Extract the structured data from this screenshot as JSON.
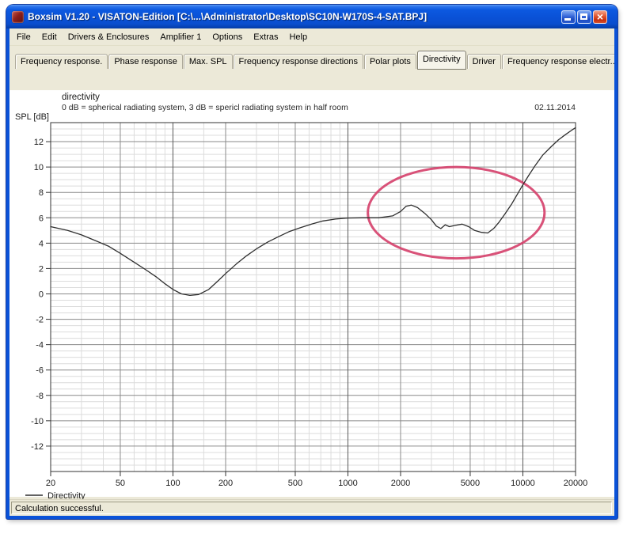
{
  "window": {
    "title": "Boxsim V1.20 - VISATON-Edition [C:\\...\\Administrator\\Desktop\\SC10N-W170S-4-SAT.BPJ]"
  },
  "menu": {
    "items": [
      "File",
      "Edit",
      "Drivers & Enclosures",
      "Amplifier 1",
      "Options",
      "Extras",
      "Help"
    ]
  },
  "tabs": {
    "active": "Directivity",
    "items": [
      "Frequency response.",
      "Phase response",
      "Max. SPL",
      "Frequency response directions",
      "Polar plots",
      "Directivity",
      "Driver",
      "Frequency response electr.."
    ]
  },
  "status": {
    "text": "Calculation successful."
  },
  "colors": {
    "accent_titlebar": "#0a52d8",
    "chrome_bg": "#ece9d8",
    "grid_minor": "#dcdcdc",
    "grid_major": "#8a8a8a",
    "grid_decade": "#5a5a5a",
    "plot_border": "#333333",
    "curve": "#2e2e2e",
    "annotation": "#d6436e"
  },
  "chart_data": {
    "type": "line",
    "title": "directivity",
    "subtitle": "0 dB = spherical radiating system, 3 dB = spericl radiating system in half room",
    "date_label": "02.11.2014",
    "ylabel": "SPL [dB]",
    "xscale": "log",
    "xlim": [
      20,
      20000
    ],
    "ylim": [
      -14,
      13.5
    ],
    "grid": "on",
    "legend_position": "bottom-left",
    "y_tick_values": [
      12,
      10,
      8,
      6,
      4,
      2,
      0,
      -2,
      -4,
      -6,
      -8,
      -10,
      -12
    ],
    "y_minor_step": 0.5,
    "y_major_step": 2,
    "x_tick_labels": [
      "20",
      "50",
      "100",
      "200",
      "500",
      "1000",
      "2000",
      "5000",
      "10000",
      "20000"
    ],
    "x_tick_values": [
      20,
      50,
      100,
      200,
      500,
      1000,
      2000,
      5000,
      10000,
      20000
    ],
    "x_decade_lines": [
      100,
      1000,
      10000
    ],
    "x_labeled_lines": [
      50,
      200,
      500,
      2000,
      5000
    ],
    "x_minor_lines": [
      30,
      40,
      60,
      70,
      80,
      90,
      150,
      300,
      400,
      600,
      700,
      800,
      900,
      1500,
      3000,
      4000,
      6000,
      7000,
      8000,
      9000,
      15000
    ],
    "series": [
      {
        "name": "Directivity",
        "points": [
          [
            20,
            5.3
          ],
          [
            25,
            5.0
          ],
          [
            30,
            4.65
          ],
          [
            36,
            4.2
          ],
          [
            43,
            3.75
          ],
          [
            50,
            3.2
          ],
          [
            60,
            2.5
          ],
          [
            70,
            1.9
          ],
          [
            80,
            1.35
          ],
          [
            90,
            0.8
          ],
          [
            100,
            0.35
          ],
          [
            112,
            0.0
          ],
          [
            125,
            -0.12
          ],
          [
            140,
            -0.05
          ],
          [
            160,
            0.35
          ],
          [
            180,
            1.0
          ],
          [
            200,
            1.6
          ],
          [
            230,
            2.35
          ],
          [
            260,
            2.95
          ],
          [
            300,
            3.55
          ],
          [
            350,
            4.1
          ],
          [
            400,
            4.5
          ],
          [
            460,
            4.9
          ],
          [
            530,
            5.2
          ],
          [
            620,
            5.5
          ],
          [
            720,
            5.75
          ],
          [
            850,
            5.9
          ],
          [
            1000,
            5.98
          ],
          [
            1200,
            6.0
          ],
          [
            1500,
            6.0
          ],
          [
            1800,
            6.15
          ],
          [
            2000,
            6.5
          ],
          [
            2150,
            6.9
          ],
          [
            2300,
            7.0
          ],
          [
            2500,
            6.8
          ],
          [
            2750,
            6.35
          ],
          [
            3000,
            5.85
          ],
          [
            3200,
            5.35
          ],
          [
            3400,
            5.15
          ],
          [
            3600,
            5.45
          ],
          [
            3800,
            5.3
          ],
          [
            4100,
            5.4
          ],
          [
            4500,
            5.5
          ],
          [
            4900,
            5.3
          ],
          [
            5300,
            5.0
          ],
          [
            5800,
            4.85
          ],
          [
            6300,
            4.8
          ],
          [
            6800,
            5.15
          ],
          [
            7300,
            5.65
          ],
          [
            7900,
            6.3
          ],
          [
            8600,
            7.05
          ],
          [
            9300,
            7.85
          ],
          [
            10000,
            8.6
          ],
          [
            10800,
            9.35
          ],
          [
            11800,
            10.15
          ],
          [
            13000,
            10.95
          ],
          [
            14500,
            11.6
          ],
          [
            16000,
            12.15
          ],
          [
            17500,
            12.55
          ],
          [
            19000,
            12.9
          ],
          [
            20000,
            13.1
          ]
        ]
      }
    ],
    "annotation_ellipse": {
      "f_min": 1300,
      "f_max": 13300,
      "db_min": 2.8,
      "db_max": 10.0
    }
  }
}
